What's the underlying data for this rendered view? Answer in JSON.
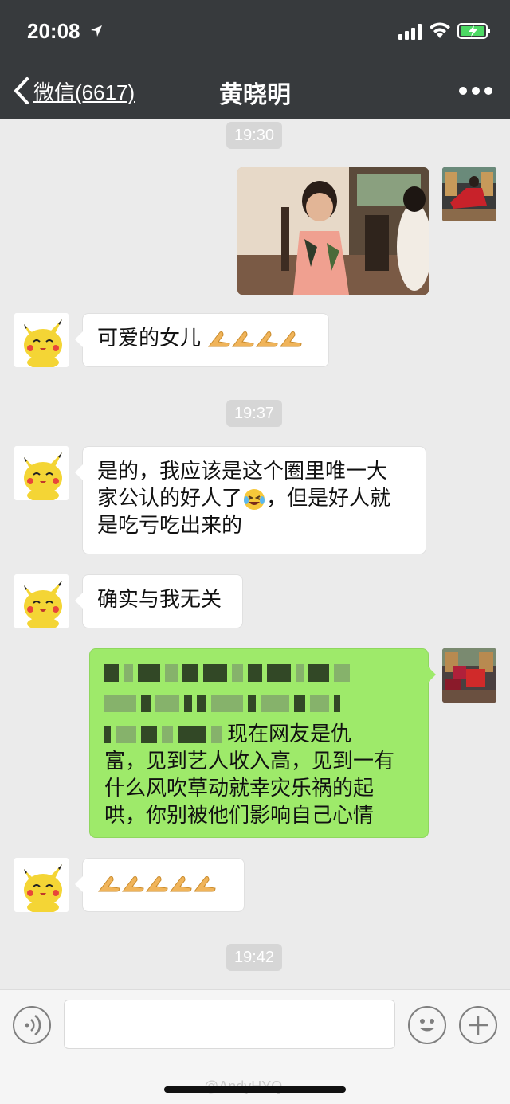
{
  "status_bar": {
    "time": "20:08"
  },
  "nav": {
    "back_label": "微信(6617)",
    "title": "黄晓明"
  },
  "timestamps": [
    "19:30",
    "19:37",
    "19:42"
  ],
  "messages": {
    "m2": "可爱的女儿",
    "m3_line1": "是的，我应该是这个圈里唯一大",
    "m3_line2a": "家公认的好人了",
    "m3_line2b": "，但是好人就",
    "m3_line3": "是吃亏吃出来的",
    "m4": "确实与我无关",
    "m5_line3_tail": "现在网友是仇",
    "m5_line4": "富，见到艺人收入高，见到一有",
    "m5_line5": "什么风吹草动就幸灾乐祸的起",
    "m5_line6": "哄，你别被他们影响自己心情"
  },
  "watermark": "@AndyHYQ",
  "icons": {
    "location": "location-arrow-icon",
    "signal": "signal-icon",
    "wifi": "wifi-icon",
    "battery": "battery-charging-icon",
    "back": "chevron-left-icon",
    "more": "more-dots-icon",
    "voice": "voice-icon",
    "emoji": "emoji-icon",
    "plus": "plus-icon",
    "hand": "folded-hands-emoji",
    "laugh": "laughing-tears-emoji"
  },
  "colors": {
    "header": "#373a3d",
    "chat_bg": "#ebebeb",
    "sent_bubble": "#9eea6a",
    "received_bubble": "#ffffff",
    "timestamp_bg": "#d6d6d6"
  }
}
